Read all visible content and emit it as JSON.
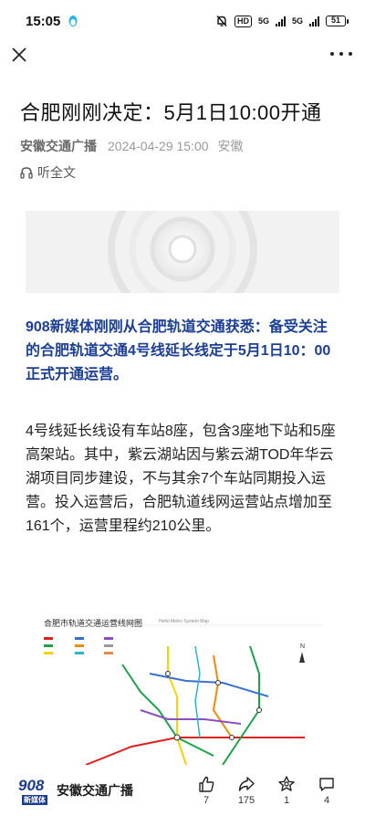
{
  "status_bar": {
    "time": "15:05",
    "hd_label": "HD",
    "signal1": "5G",
    "signal2": "5G",
    "battery": "51"
  },
  "article": {
    "title": "合肥刚刚决定：5月1日10:00开通",
    "source": "安徽交通广播",
    "date": "2024-04-29 15:00",
    "region": "安徽",
    "listen_label": "听全文",
    "lead": "908新媒体刚刚从合肥轨道交通获悉：备受关注的合肥轨道交通4号线延长线定于5月1日10：00正式开通运营。",
    "body": "4号线延长线设有车站8座，包含3座地下站和5座高架站。其中，紫云湖站因与紫云湖TOD年华云湖项目同步建设，不与其余7个车站同期投入运营。投入运营后，合肥轨道线网运营站点增加至161个，运营里程约210公里。"
  },
  "map_image": {
    "title": "合肥市轨道交通运营线网图",
    "title_en": "Hefei Metro System Map",
    "compass": "N"
  },
  "bottom_bar": {
    "logo_num": "908",
    "logo_sub": "新媒体",
    "source_name": "安徽交通广播",
    "like_count": "7",
    "share_count": "175",
    "favorite_count": "1",
    "comment_count": "4"
  },
  "colors": {
    "lead_text": "#1c3f94",
    "brand_blue": "#1a3a8f"
  },
  "icons": [
    "close-icon",
    "more-icon",
    "headphone-icon",
    "like-icon",
    "share-icon",
    "favorite-icon",
    "comment-icon"
  ]
}
